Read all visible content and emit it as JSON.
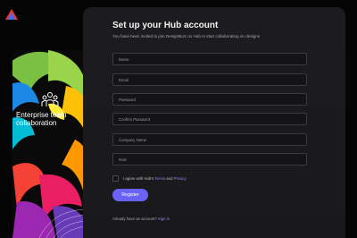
{
  "brand": {
    "logo_icon": "triangle-logo-icon",
    "logo_colors": [
      "#e53935",
      "#3b6cf6"
    ]
  },
  "hero": {
    "caption": "Enterprise team collaboration",
    "icon": "team-icon",
    "colors": [
      "#7bc043",
      "#1e88e5",
      "#ffc107",
      "#f44336",
      "#9c27b0",
      "#00bcd4",
      "#e91e63"
    ]
  },
  "form": {
    "title": "Set up your Hub account",
    "subtitle": "You have been invited to join DesignBuX on Hub to start collaborating on designs",
    "fields": {
      "name": "Name",
      "email": "Email",
      "password": "Password",
      "confirm_password": "Confirm Password",
      "company": "Company Name",
      "role": "Role"
    },
    "agree": {
      "prefix": "I agree with Hub's",
      "terms": "Terms",
      "and": "and",
      "privacy": "Privacy"
    },
    "register_label": "Register",
    "signin_prompt": "Already have an account?",
    "signin_link": "Sign in"
  },
  "colors": {
    "accent": "#6a62f5",
    "link": "#8a84ff",
    "panel": "#1c1c1f",
    "background": "#050505"
  }
}
